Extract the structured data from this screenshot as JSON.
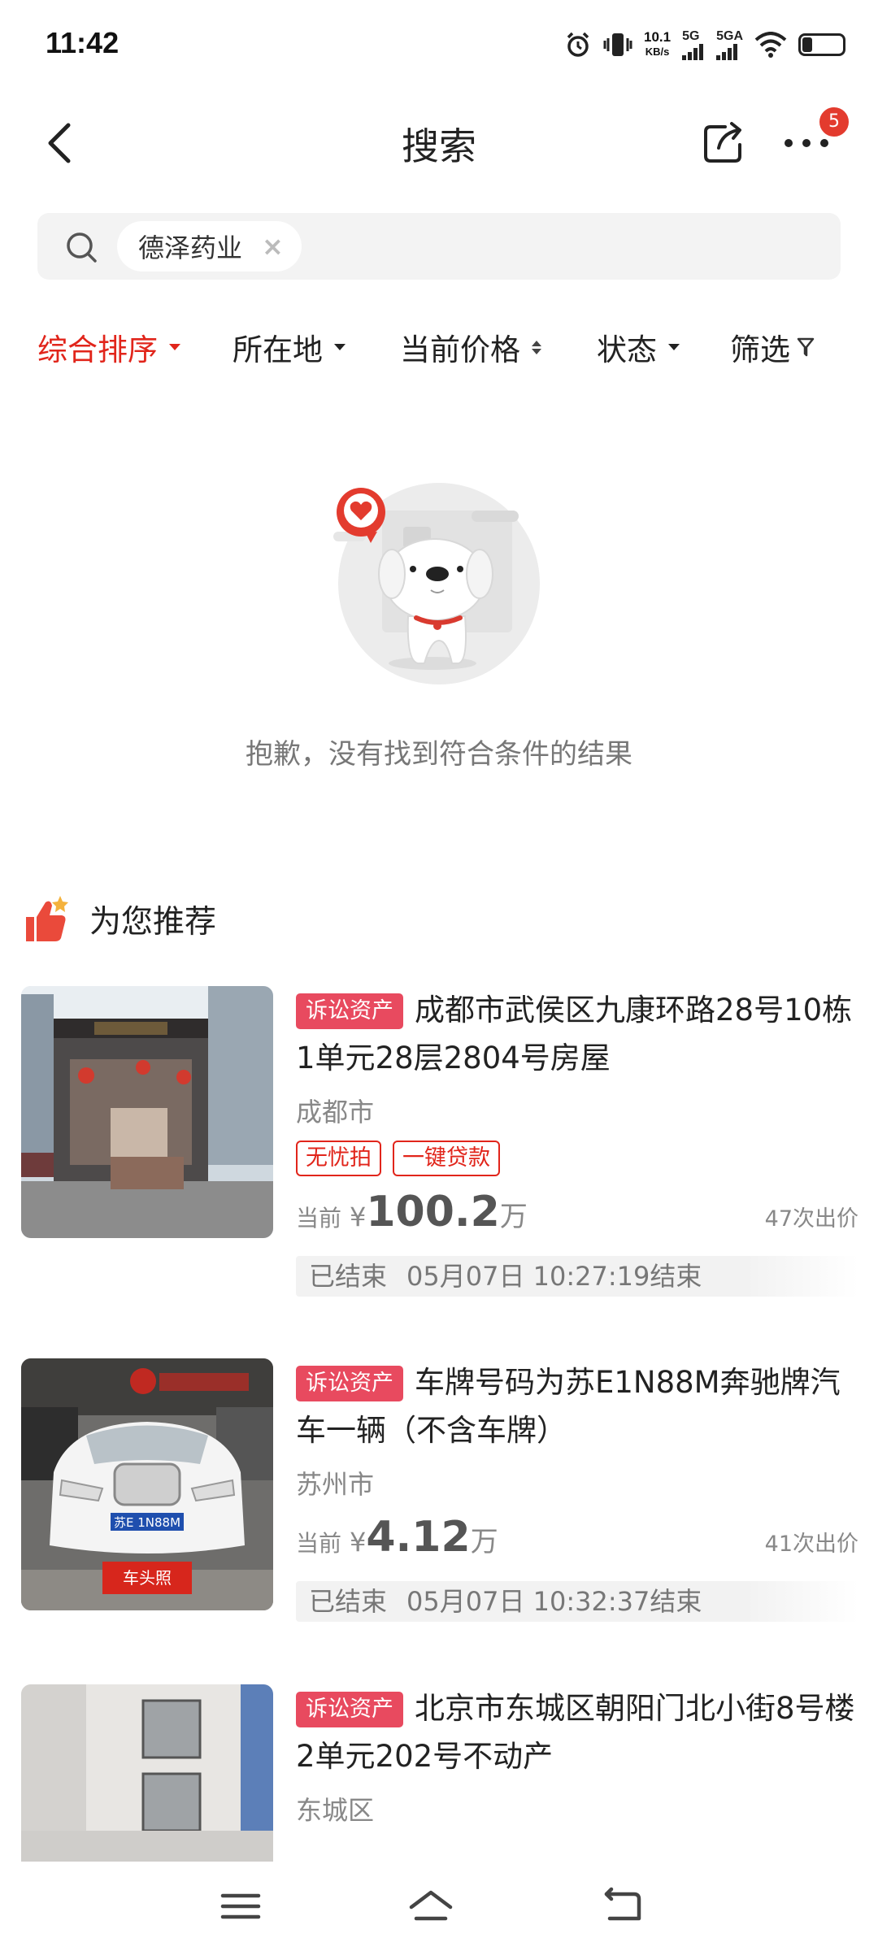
{
  "status_bar": {
    "time": "11:42",
    "speed_value": "10.1",
    "speed_unit": "KB/s",
    "sig1_label": "5G",
    "sig2_label": "5GA",
    "battery_level": 0.24
  },
  "header": {
    "title": "搜索",
    "notification_count": "5"
  },
  "search": {
    "chip_text": "德泽药业",
    "chip_close": "×"
  },
  "filters": [
    {
      "label": "综合排序",
      "active": true
    },
    {
      "label": "所在地"
    },
    {
      "label": "当前价格"
    },
    {
      "label": "状态"
    },
    {
      "label": "筛选"
    }
  ],
  "empty_state": {
    "message": "抱歉，没有找到符合条件的结果"
  },
  "recommend": {
    "title": "为您推荐",
    "items": [
      {
        "tag": "诉讼资产",
        "title": "成都市武侯区九康环路28号10栋1单元28层2804号房屋",
        "city": "成都市",
        "pills": [
          "无忧拍",
          "一键贷款"
        ],
        "price_prefix": "当前",
        "price_symbol": "¥",
        "price": "100.2",
        "price_unit": "万",
        "bids": "47次出价",
        "status": "已结束",
        "end_time": "05月07日 10:27:19结束"
      },
      {
        "tag": "诉讼资产",
        "title": "车牌号码为苏E1N88M奔驰牌汽车一辆（不含车牌）",
        "city": "苏州市",
        "price_prefix": "当前",
        "price_symbol": "¥",
        "price": "4.12",
        "price_unit": "万",
        "bids": "41次出价",
        "status": "已结束",
        "end_time": "05月07日 10:32:37结束",
        "image_label": "车头照",
        "plate": "苏E 1N88M"
      },
      {
        "tag": "诉讼资产",
        "title": "北京市东城区朝阳门北小街8号楼2单元202号不动产",
        "city": "东城区"
      }
    ]
  }
}
